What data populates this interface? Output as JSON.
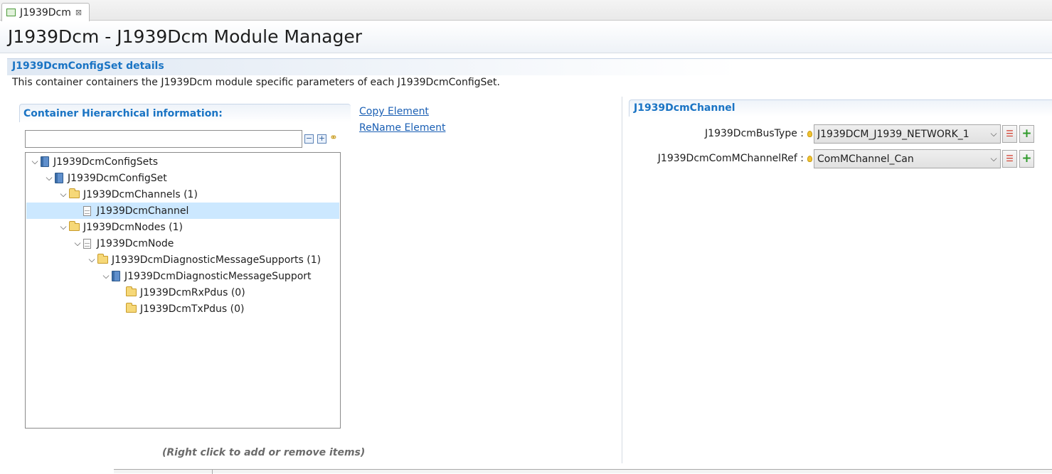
{
  "tab": {
    "title": "J1939Dcm",
    "close_glyph": "⊠"
  },
  "header": {
    "title": "J1939Dcm - J1939Dcm Module Manager"
  },
  "section": {
    "title": "J1939DcmConfigSet details",
    "description": "This container containers the J1939Dcm module specific parameters of each J1939DcmConfigSet."
  },
  "hierarchy": {
    "title": "Container Hierarchical information:",
    "filter_value": "",
    "tree": [
      {
        "label": "J1939DcmConfigSets",
        "icon": "config-icon",
        "expanded": true,
        "depth": 0
      },
      {
        "label": "J1939DcmConfigSet",
        "icon": "config-icon",
        "expanded": true,
        "depth": 1
      },
      {
        "label": "J1939DcmChannels (1)",
        "icon": "folder-icon",
        "expanded": true,
        "depth": 2
      },
      {
        "label": "J1939DcmChannel",
        "icon": "document-icon",
        "expanded": null,
        "depth": 3,
        "selected": true
      },
      {
        "label": "J1939DcmNodes (1)",
        "icon": "folder-icon",
        "expanded": true,
        "depth": 2
      },
      {
        "label": "J1939DcmNode",
        "icon": "document-icon",
        "expanded": true,
        "depth": 3
      },
      {
        "label": "J1939DcmDiagnosticMessageSupports (1)",
        "icon": "folder-icon",
        "expanded": true,
        "depth": 4
      },
      {
        "label": "J1939DcmDiagnosticMessageSupport",
        "icon": "config-icon",
        "expanded": true,
        "depth": 5
      },
      {
        "label": "J1939DcmRxPdus (0)",
        "icon": "folder-icon",
        "expanded": null,
        "depth": 6
      },
      {
        "label": "J1939DcmTxPdus (0)",
        "icon": "folder-icon",
        "expanded": null,
        "depth": 6
      }
    ],
    "hint": "(Right click to add or remove items)"
  },
  "actions": {
    "copy": "Copy Element",
    "rename": "ReName Element"
  },
  "details": {
    "title": "J1939DcmChannel",
    "properties": [
      {
        "label": "J1939DcmBusType :",
        "value": "J1939DCM_J1939_NETWORK_1"
      },
      {
        "label": "J1939DcmComMChannelRef :",
        "value": "ComMChannel_Can"
      }
    ]
  },
  "colors": {
    "accent": "#1a74c4",
    "link": "#1a5fb4",
    "selection": "#cce8ff"
  }
}
